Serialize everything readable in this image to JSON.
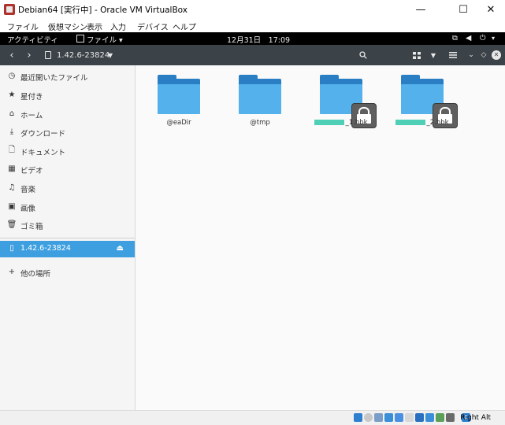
{
  "window": {
    "title": "Debian64 [実行中] - Oracle VM VirtualBox",
    "minimize": "—",
    "maximize": "☐",
    "close": "✕"
  },
  "vbox_menu": [
    "ファイル",
    "仮想マシン",
    "表示",
    "入力",
    "デバイス",
    "ヘルプ"
  ],
  "topbar": {
    "activities": "アクティビティ",
    "app_menu": "ファイル ▾",
    "clock": "12月31日　17:09",
    "status_icons": [
      "network-icon",
      "volume-icon",
      "power-icon"
    ]
  },
  "headerbar": {
    "location": "1.42.6-23824"
  },
  "sidebar": {
    "items": [
      {
        "icon": "recent-icon",
        "label": "最近開いたファイル"
      },
      {
        "icon": "star-icon",
        "label": "星付き"
      },
      {
        "icon": "home-icon",
        "label": "ホーム"
      },
      {
        "icon": "download-icon",
        "label": "ダウンロード"
      },
      {
        "icon": "document-icon",
        "label": "ドキュメント"
      },
      {
        "icon": "video-icon",
        "label": "ビデオ"
      },
      {
        "icon": "music-icon",
        "label": "音楽"
      },
      {
        "icon": "picture-icon",
        "label": "画像"
      },
      {
        "icon": "trash-icon",
        "label": "ゴミ箱"
      }
    ],
    "mounted": {
      "icon": "drive-icon",
      "label": "1.42.6-23824",
      "selected": true
    },
    "other": {
      "icon": "plus-icon",
      "label": "他の場所"
    }
  },
  "files": [
    {
      "name": "@eaDir",
      "locked": false,
      "redacted": false
    },
    {
      "name": "@tmp",
      "locked": false,
      "redacted": false
    },
    {
      "name": "_1.hbk",
      "locked": true,
      "redacted": true
    },
    {
      "name": "_2.hbk",
      "locked": true,
      "redacted": true
    }
  ],
  "statusbar": {
    "host_key": "Right Alt"
  },
  "colors": {
    "accent": "#3d9fe0",
    "folder_front": "#54b1ec",
    "folder_back": "#2a7fc4",
    "redaction": "#4fd0b6"
  }
}
